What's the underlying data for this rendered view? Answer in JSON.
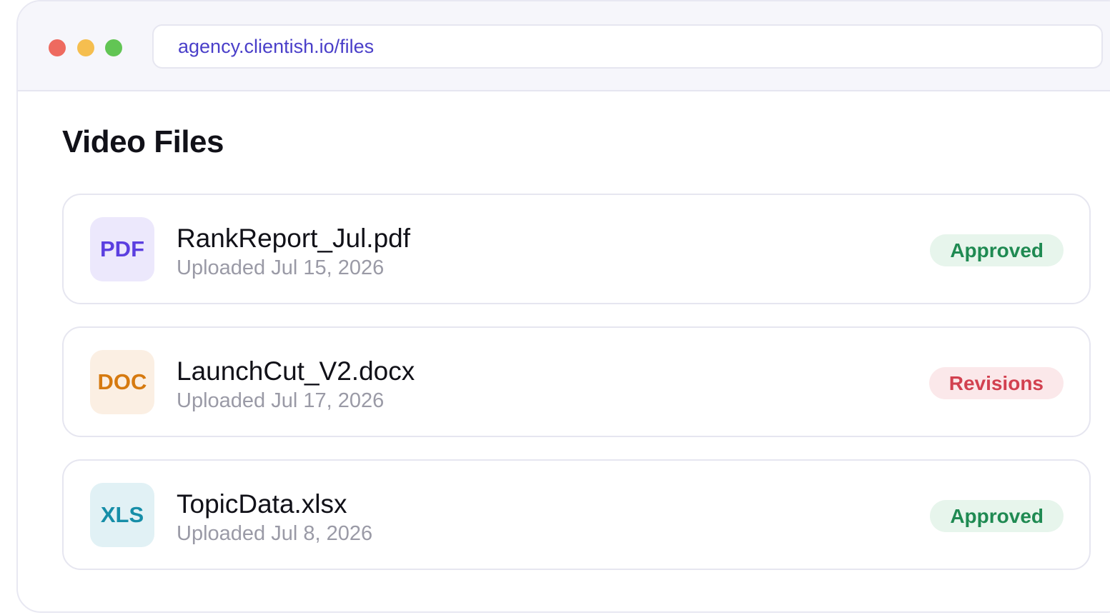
{
  "browser": {
    "url": "agency.clientish.io/files"
  },
  "page": {
    "title": "Video Files"
  },
  "files": [
    {
      "type_label": "PDF",
      "type_icon": "pdf-file-icon",
      "icon_color": "#5b3fe0",
      "icon_bg": "#ece8fc",
      "name": "RankReport_Jul.pdf",
      "uploaded": "Uploaded Jul 15, 2026",
      "status": "Approved",
      "status_color": "#1f8a52",
      "status_bg": "#e7f5ec"
    },
    {
      "type_label": "DOC",
      "type_icon": "doc-file-icon",
      "icon_color": "#d67a10",
      "icon_bg": "#fbefe3",
      "name": "LaunchCut_V2.docx",
      "uploaded": "Uploaded Jul 17, 2026",
      "status": "Revisions",
      "status_color": "#d2404f",
      "status_bg": "#fbe8ea"
    },
    {
      "type_label": "XLS",
      "type_icon": "xls-file-icon",
      "icon_color": "#168ea8",
      "icon_bg": "#e1f1f5",
      "name": "TopicData.xlsx",
      "uploaded": "Uploaded Jul 8, 2026",
      "status": "Approved",
      "status_color": "#1f8a52",
      "status_bg": "#e7f5ec"
    }
  ]
}
